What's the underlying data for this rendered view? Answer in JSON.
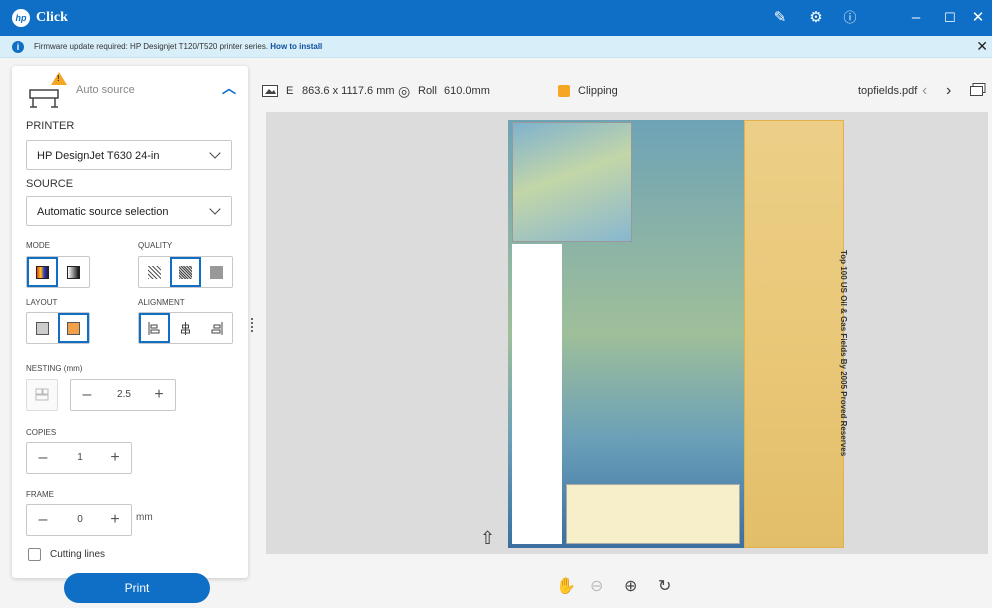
{
  "app": {
    "title": "Click"
  },
  "banner": {
    "message": "Firmware update required: HP Designjet T120/T520 printer series.",
    "link": "How to install"
  },
  "panel": {
    "source_header": "Auto source",
    "printer_label": "PRINTER",
    "printer_value": "HP DesignJet T630 24-in",
    "source_label": "SOURCE",
    "source_value": "Automatic source selection",
    "mode_label": "MODE",
    "quality_label": "QUALITY",
    "layout_label": "LAYOUT",
    "alignment_label": "ALIGNMENT",
    "nesting_label": "NESTING (mm)",
    "nesting_value": "2.5",
    "copies_label": "COPIES",
    "copies_value": "1",
    "frame_label": "FRAME",
    "frame_value": "0",
    "frame_unit": "mm",
    "cutting_lines_label": "Cutting lines"
  },
  "print_label": "Print",
  "toolbar": {
    "size_code": "E",
    "size": "863.6 x 1117.6 mm",
    "roll": "Roll",
    "roll_width": "610.0mm",
    "clipping": "Clipping",
    "filename": "topfields.pdf"
  },
  "preview": {
    "vertical_title": "Top 100 US Oil & Gas Fields By 2005 Proved Reserves"
  },
  "colors": {
    "accent": "#0f6fc6",
    "warning": "#f5a623",
    "banner": "#d8eef8"
  }
}
